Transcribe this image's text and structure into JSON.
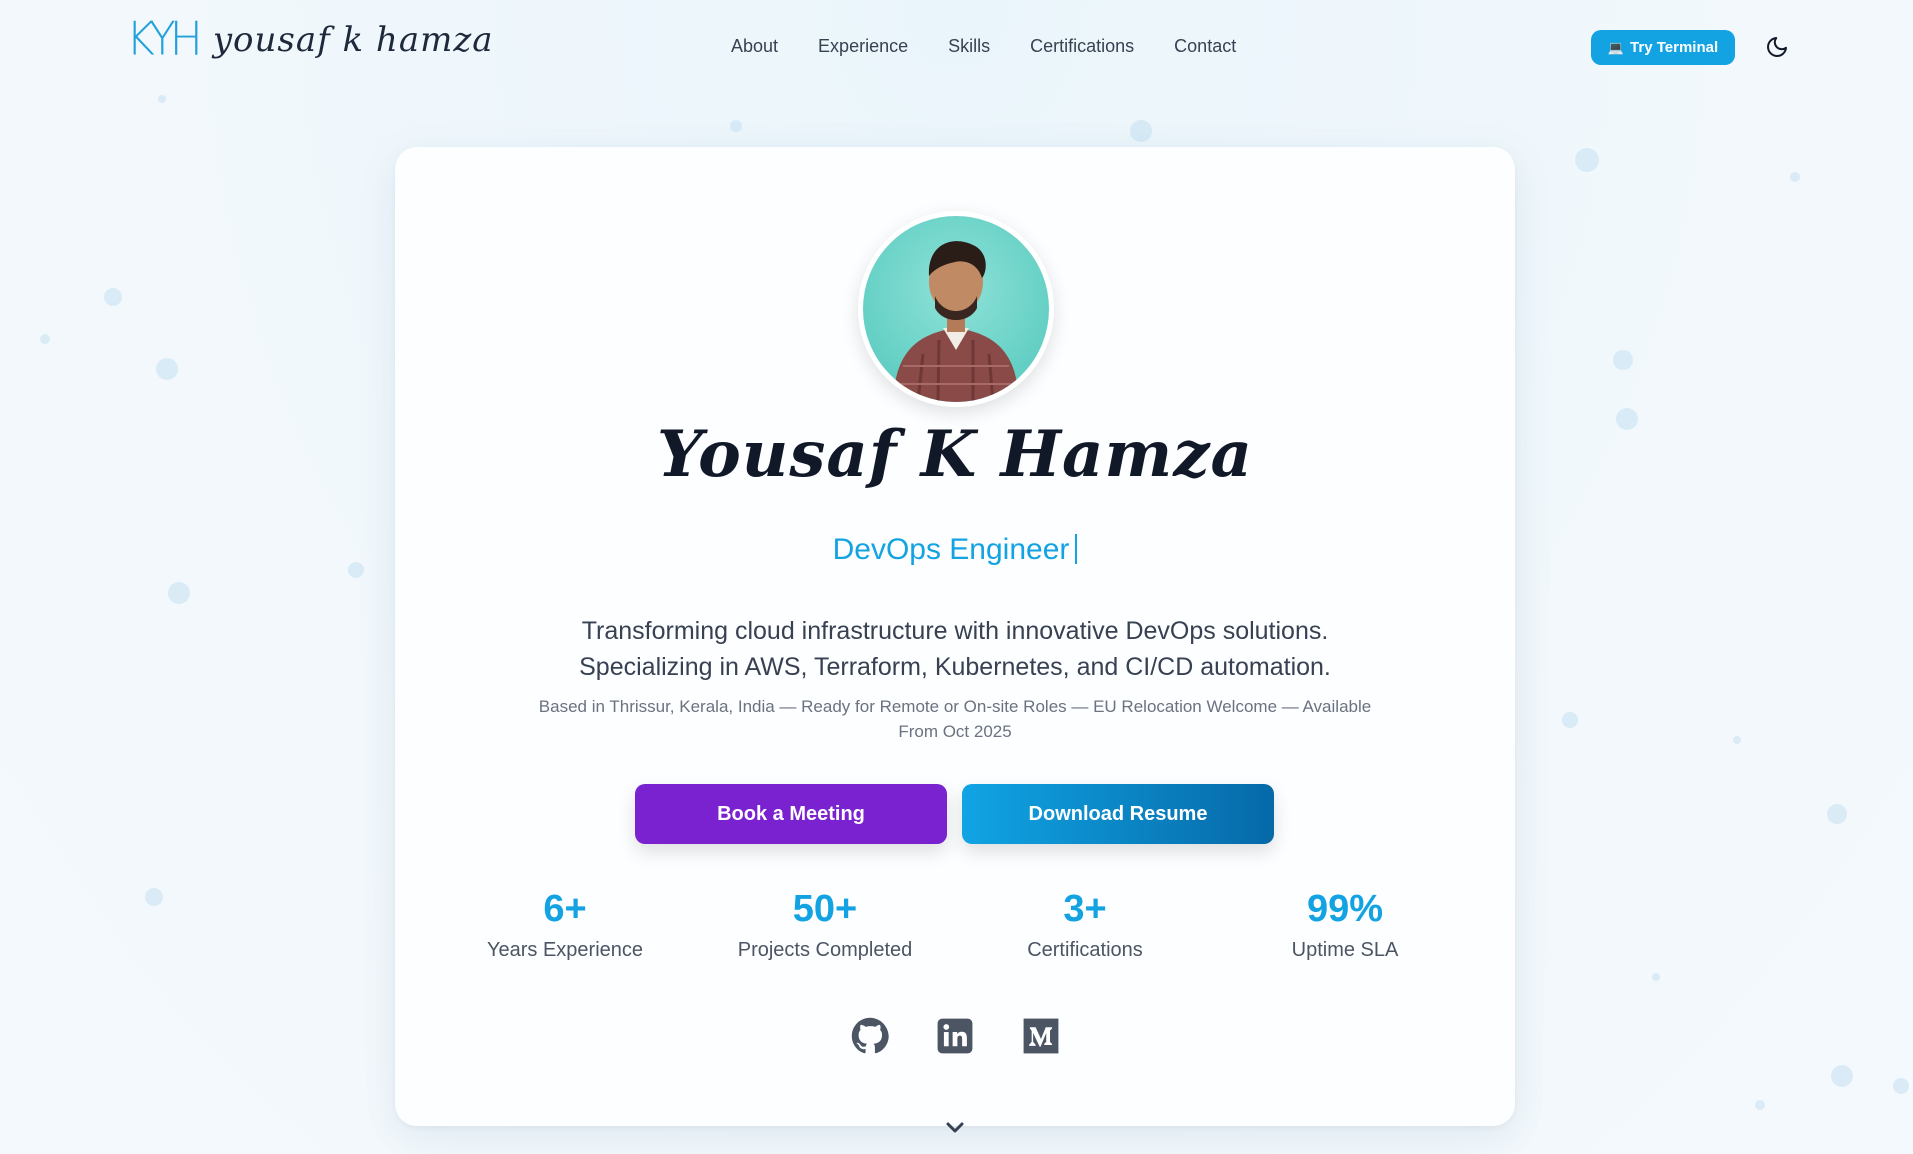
{
  "nav": {
    "logo_mark": "KYH",
    "logo_text": "yousaf k hamza",
    "links": [
      "About",
      "Experience",
      "Skills",
      "Certifications",
      "Contact"
    ],
    "terminal_label": "Try Terminal",
    "terminal_icon": "laptop-icon",
    "theme_icon": "moon-icon"
  },
  "hero": {
    "name": "Yousaf K Hamza",
    "role": "DevOps Engineer",
    "tagline_line1": "Transforming cloud infrastructure with innovative DevOps solutions.",
    "tagline_line2": "Specializing in AWS, Terraform, Kubernetes, and CI/CD automation.",
    "location": "Based in Thrissur, Kerala, India — Ready for Remote or On-site Roles — EU Relocation Welcome — Available From Oct 2025",
    "primary_button": "Book a Meeting",
    "secondary_button": "Download Resume"
  },
  "stats": [
    {
      "value": "6+",
      "label": "Years Experience"
    },
    {
      "value": "50+",
      "label": "Projects Completed"
    },
    {
      "value": "3+",
      "label": "Certifications"
    },
    {
      "value": "99%",
      "label": "Uptime SLA"
    }
  ],
  "social": [
    "github-icon",
    "linkedin-icon",
    "medium-icon"
  ],
  "colors": {
    "accent": "#13a3e2",
    "meeting_button": "#7b22d0",
    "resume_gradient_start": "#10a4e4",
    "resume_gradient_end": "#0669a8"
  }
}
